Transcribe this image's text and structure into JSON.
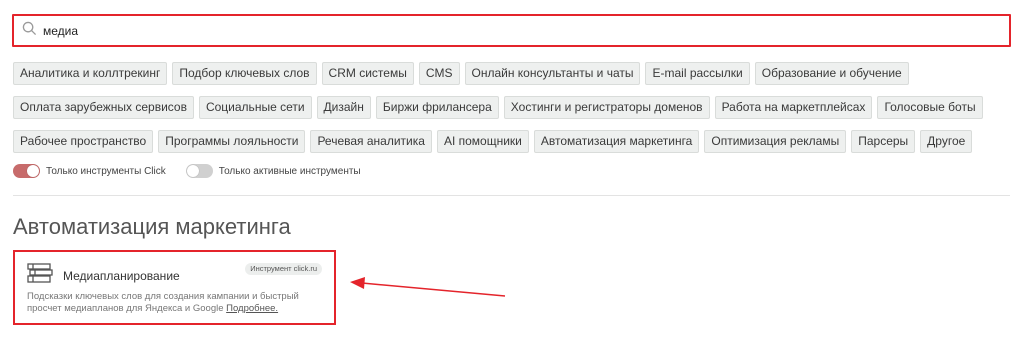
{
  "search": {
    "value": "медиа",
    "icon": "search-icon"
  },
  "tag_rows": [
    [
      "Аналитика и коллтрекинг",
      "Подбор ключевых слов",
      "CRM системы",
      "CMS",
      "Онлайн консультанты и чаты",
      "E-mail рассылки",
      "Образование и обучение"
    ],
    [
      "Оплата зарубежных сервисов",
      "Социальные сети",
      "Дизайн",
      "Биржи фрилансера",
      "Хостинги и регистраторы доменов",
      "Работа на маркетплейсах",
      "Голосовые боты"
    ],
    [
      "Рабочее пространство",
      "Программы лояльности",
      "Речевая аналитика",
      "AI помощники",
      "Автоматизация маркетинга",
      "Оптимизация рекламы",
      "Парсеры",
      "Другое"
    ]
  ],
  "toggles": [
    {
      "label": "Только инструменты Click",
      "state": "on"
    },
    {
      "label": "Только активные инструменты",
      "state": "off"
    }
  ],
  "section": {
    "title": "Автоматизация маркетинга"
  },
  "card": {
    "title": "Медиапланирование",
    "badge": "Инструмент click.ru",
    "description": "Подсказки ключевых слов для создания кампании и быстрый просчет медиапланов для Яндекса и Google",
    "link": "Подробнее.",
    "icon": "books-icon"
  },
  "colors": {
    "highlight": "#e4242b",
    "toggle_on": "#c76b6b",
    "tag_bg": "#eef0ef"
  }
}
